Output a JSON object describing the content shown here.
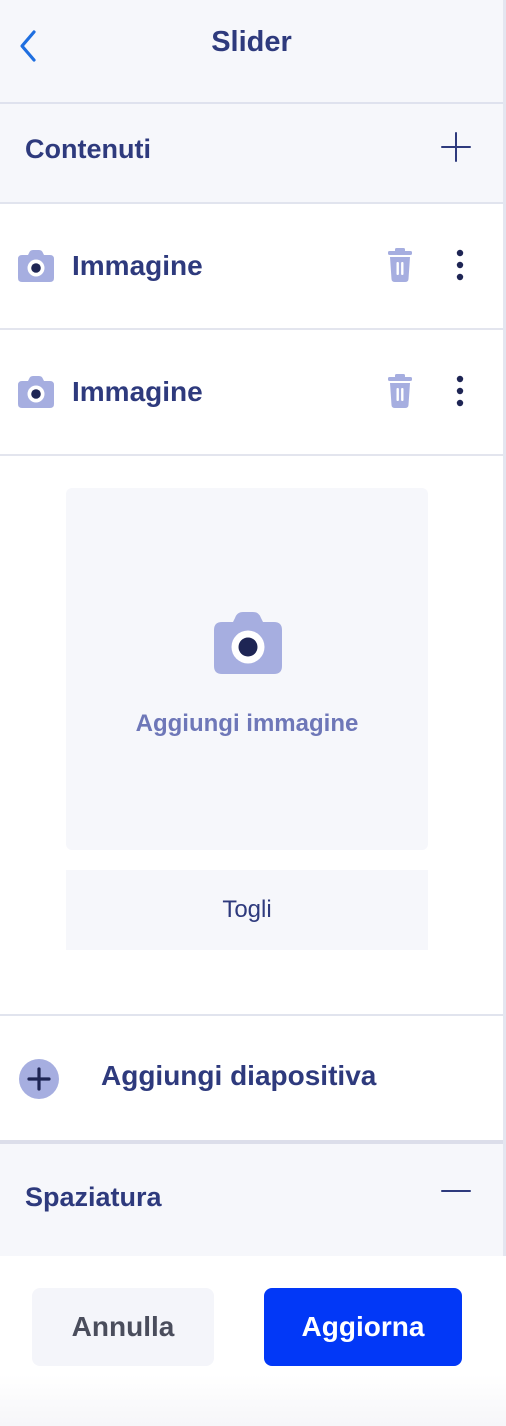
{
  "header": {
    "title": "Slider",
    "back_icon": "chevron-left-icon"
  },
  "contents_section": {
    "title": "Contenuti",
    "action_icon": "plus-icon"
  },
  "items": [
    {
      "label": "Immagine",
      "icon": "camera-icon"
    },
    {
      "label": "Immagine",
      "icon": "camera-icon"
    }
  ],
  "upload": {
    "label": "Aggiungi immagine",
    "remove_label": "Togli"
  },
  "add_slide": {
    "label": "Aggiungi diapositiva",
    "icon": "plus-circle-icon"
  },
  "spacing_section": {
    "title": "Spaziatura",
    "action_icon": "minus-icon"
  },
  "footer": {
    "cancel_label": "Annulla",
    "update_label": "Aggiorna"
  },
  "colors": {
    "accent": "#0238f7",
    "title_text": "#2e3a7d",
    "icon_fill": "#a6aee0",
    "panel_bg": "#f6f7fb"
  }
}
